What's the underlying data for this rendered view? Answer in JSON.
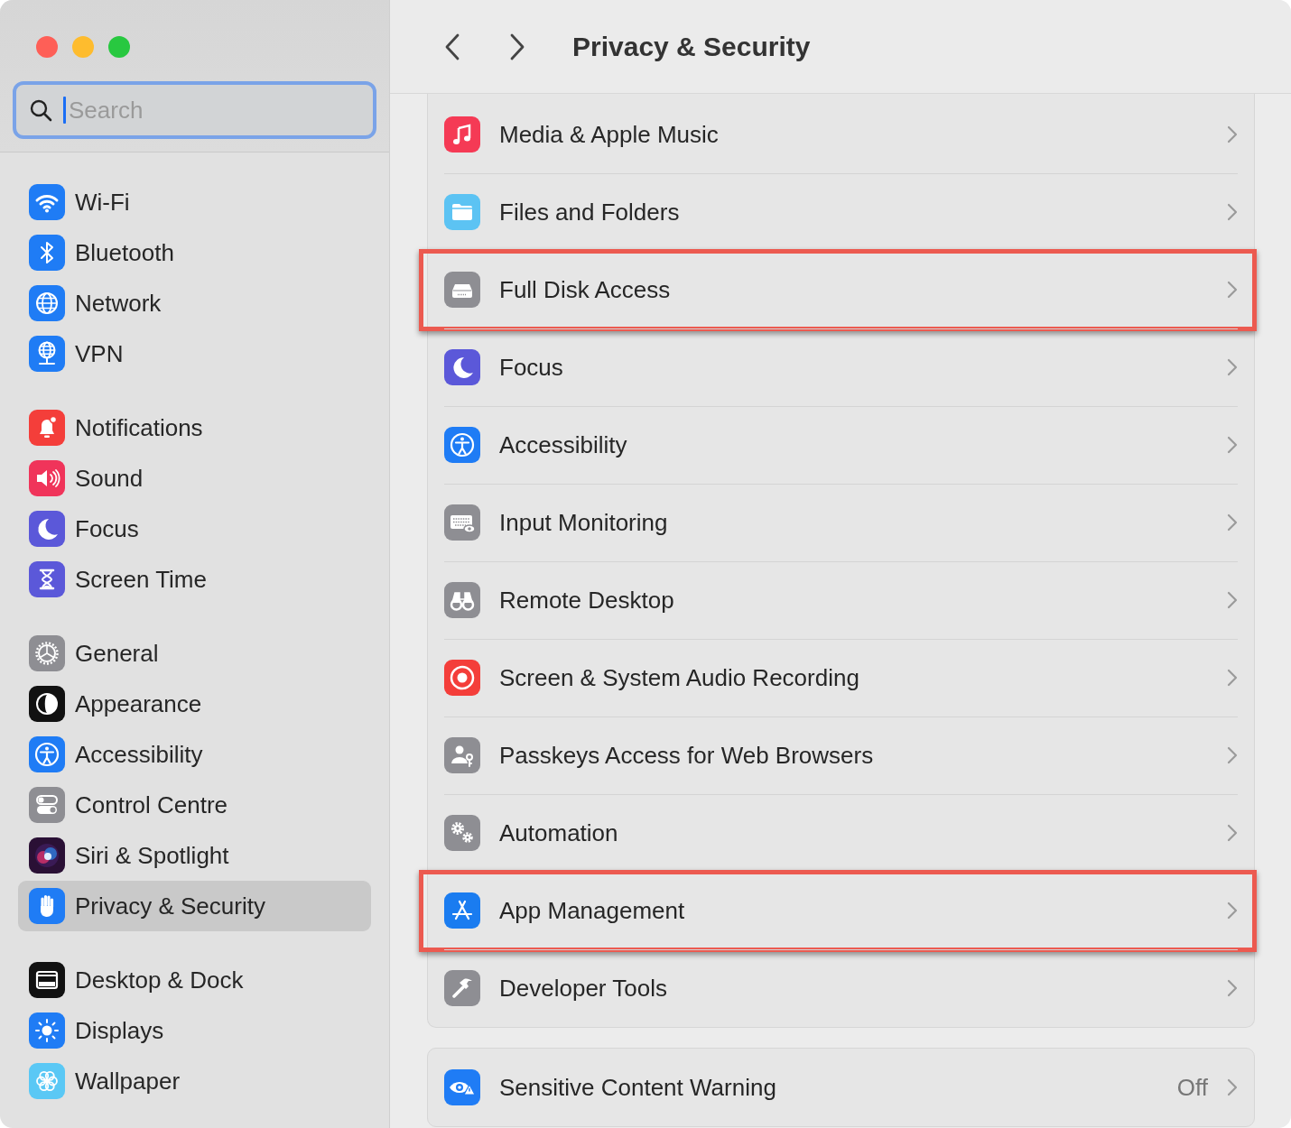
{
  "window": {
    "title": "Privacy & Security"
  },
  "search": {
    "placeholder": "Search"
  },
  "sidebar": {
    "groups": [
      {
        "items": [
          {
            "label": "Wi-Fi",
            "selected": false
          },
          {
            "label": "Bluetooth",
            "selected": false
          },
          {
            "label": "Network",
            "selected": false
          },
          {
            "label": "VPN",
            "selected": false
          }
        ]
      },
      {
        "items": [
          {
            "label": "Notifications",
            "selected": false
          },
          {
            "label": "Sound",
            "selected": false
          },
          {
            "label": "Focus",
            "selected": false
          },
          {
            "label": "Screen Time",
            "selected": false
          }
        ]
      },
      {
        "items": [
          {
            "label": "General",
            "selected": false
          },
          {
            "label": "Appearance",
            "selected": false
          },
          {
            "label": "Accessibility",
            "selected": false
          },
          {
            "label": "Control Centre",
            "selected": false
          },
          {
            "label": "Siri & Spotlight",
            "selected": false
          },
          {
            "label": "Privacy & Security",
            "selected": true
          }
        ]
      },
      {
        "items": [
          {
            "label": "Desktop & Dock",
            "selected": false
          },
          {
            "label": "Displays",
            "selected": false
          },
          {
            "label": "Wallpaper",
            "selected": false
          }
        ]
      }
    ]
  },
  "sections": [
    {
      "rows": [
        {
          "label": "Media & Apple Music",
          "highlighted": false
        },
        {
          "label": "Files and Folders",
          "highlighted": false
        },
        {
          "label": "Full Disk Access",
          "highlighted": true
        },
        {
          "label": "Focus",
          "highlighted": false
        },
        {
          "label": "Accessibility",
          "highlighted": false
        },
        {
          "label": "Input Monitoring",
          "highlighted": false
        },
        {
          "label": "Remote Desktop",
          "highlighted": false
        },
        {
          "label": "Screen & System Audio Recording",
          "highlighted": false
        },
        {
          "label": "Passkeys Access for Web Browsers",
          "highlighted": false
        },
        {
          "label": "Automation",
          "highlighted": false
        },
        {
          "label": "App Management",
          "highlighted": true
        },
        {
          "label": "Developer Tools",
          "highlighted": false
        }
      ]
    },
    {
      "rows": [
        {
          "label": "Sensitive Content Warning",
          "value": "Off",
          "highlighted": false
        }
      ]
    }
  ]
}
